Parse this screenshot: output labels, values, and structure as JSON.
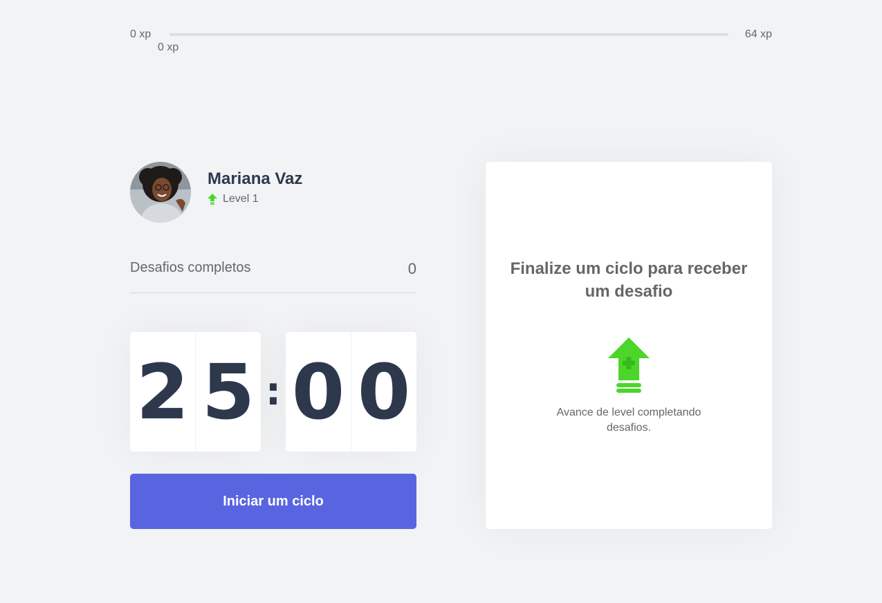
{
  "xp": {
    "min_label": "0 xp",
    "max_label": "64 xp",
    "current_label": "0 xp",
    "progress_fraction": 0
  },
  "profile": {
    "name": "Mariana Vaz",
    "level_label": "Level 1",
    "level_icon": "level-up-arrow-icon"
  },
  "challenges_completed": {
    "label": "Desafios completos",
    "count": "0"
  },
  "countdown": {
    "minute_left": "2",
    "minute_right": "5",
    "separator": ":",
    "second_left": "0",
    "second_right": "0"
  },
  "start_button": {
    "label": "Iniciar um ciclo"
  },
  "challenge_card": {
    "title": "Finalize um ciclo para receber um desafio",
    "icon": "level-up-icon",
    "description": "Avance de level completando desafios."
  },
  "colors": {
    "background": "#f2f3f5",
    "primary": "#5965e0",
    "green": "#4cd62b",
    "title": "#2e384d",
    "text": "#666666"
  }
}
